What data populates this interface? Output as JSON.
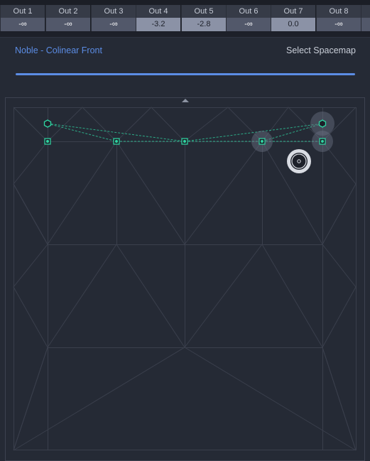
{
  "outputs": [
    {
      "label": "Out 1",
      "value": "-∞",
      "active": false
    },
    {
      "label": "Out 2",
      "value": "-∞",
      "active": false
    },
    {
      "label": "Out 3",
      "value": "-∞",
      "active": false
    },
    {
      "label": "Out 4",
      "value": "-3.2",
      "active": true
    },
    {
      "label": "Out 5",
      "value": "-2.8",
      "active": true
    },
    {
      "label": "Out 6",
      "value": "-∞",
      "active": false
    },
    {
      "label": "Out 7",
      "value": "0.0",
      "active": true
    },
    {
      "label": "Out 8",
      "value": "-∞",
      "active": false
    }
  ],
  "panel": {
    "title": "Noble - Colinear Front",
    "action": "Select Spacemap",
    "accent": "#5b8ce4"
  },
  "spacemap": {
    "node_color": "#2fd6a3",
    "line_color": "#3a3f4c",
    "grid_color": "#5a6170"
  }
}
